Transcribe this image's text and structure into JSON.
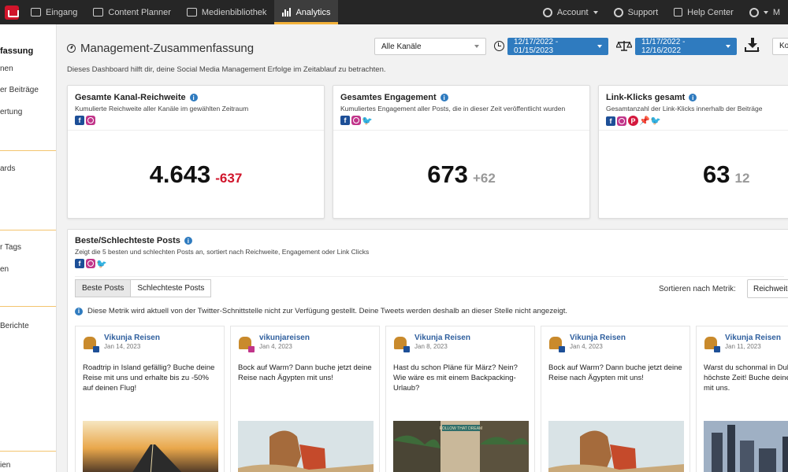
{
  "nav": {
    "items": [
      {
        "label": "Eingang",
        "icon": "inbox-icon"
      },
      {
        "label": "Content Planner",
        "icon": "calendar-icon"
      },
      {
        "label": "Medienbibliothek",
        "icon": "image-icon"
      },
      {
        "label": "Analytics",
        "icon": "bar-chart-icon",
        "active": true
      }
    ],
    "right": [
      {
        "label": "Account",
        "icon": "gear-icon"
      },
      {
        "label": "Support",
        "icon": "globe-icon"
      },
      {
        "label": "Help Center",
        "icon": "book-icon"
      },
      {
        "label": "M",
        "icon": "users-icon"
      }
    ],
    "accent": "#f3b23a",
    "brand": "#d0152b"
  },
  "sidebar": {
    "items": [
      "fassung",
      "nen",
      "er Beiträge",
      "ertung",
      "ards",
      "r Tags",
      "en",
      "Berichte",
      "ien"
    ]
  },
  "header": {
    "title": "Management-Zusammenfassung",
    "description": "Dieses Dashboard hilft dir, deine Social Media Management Erfolge im Zeitablauf zu betrachten.",
    "channel_select": "Alle Kanäle",
    "date_range": "12/17/2022 - 01/15/2023",
    "compare_range": "11/17/2022 - 12/16/2022",
    "k_select": "Ko"
  },
  "kpis": [
    {
      "title": "Gesamte Kanal-Reichweite",
      "subtitle": "Kumulierte Reichweite aller Kanäle im gewählten Zeitraum",
      "value": "4.643",
      "delta": "-637",
      "delta_type": "neg",
      "icons": [
        "fb",
        "ig"
      ]
    },
    {
      "title": "Gesamtes Engagement",
      "subtitle": "Kumuliertes Engagement aller Posts, die in dieser Zeit veröffentlicht wurden",
      "value": "673",
      "delta": "+62",
      "delta_type": "pos",
      "icons": [
        "fb",
        "ig",
        "tw"
      ]
    },
    {
      "title": "Link-Klicks gesamt",
      "subtitle": "Gesamtanzahl der Link-Klicks innerhalb der Beiträge",
      "value": "63",
      "delta": "12",
      "delta_type": "pos",
      "icons": [
        "fb",
        "ig",
        "pin",
        "pinned",
        "tw"
      ]
    }
  ],
  "posts_panel": {
    "title": "Beste/Schlechteste Posts",
    "subtitle": "Zeigt die 5 besten und schlechten Posts an, sortiert nach Reichweite, Engagement oder Link Clicks",
    "tab_best": "Beste Posts",
    "tab_worst": "Schlechteste Posts",
    "sort_label": "Sortieren nach Metrik:",
    "sort_value": "Reichweite",
    "notice": "Diese Metrik wird aktuell von der Twitter-Schnittstelle nicht zur Verfügung gestellt. Deine Tweets werden deshalb an dieser Stelle nicht angezeigt.",
    "posts": [
      {
        "name": "Vikunja Reisen",
        "date": "Jan 14, 2023",
        "network": "fb",
        "text": "Roadtrip in Island gefällig? Buche deine Reise mit uns und erhalte bis zu -50% auf deinen Flug!"
      },
      {
        "name": "vikunjareisen",
        "date": "Jan 4, 2023",
        "network": "ig",
        "text": "Bock auf Warm? Dann buche jetzt deine Reise nach Ägypten mit uns!"
      },
      {
        "name": "Vikunja Reisen",
        "date": "Jan 8, 2023",
        "network": "fb",
        "text": "Hast du schon Pläne für März? Nein? Wie wäre es mit einem Backpacking-Urlaub?"
      },
      {
        "name": "Vikunja Reisen",
        "date": "Jan 4, 2023",
        "network": "fb",
        "text": "Bock auf Warm? Dann buche jetzt deine Reise nach Ägypten mit uns!"
      },
      {
        "name": "Vikunja Reisen",
        "date": "Jan 11, 2023",
        "network": "fb",
        "text": "Warst du schonmal in Dubai? wird es höchste Zeit! Buche deine nächste Reise mit uns."
      }
    ]
  },
  "image_label": "FOLLOW THAT DREAM"
}
